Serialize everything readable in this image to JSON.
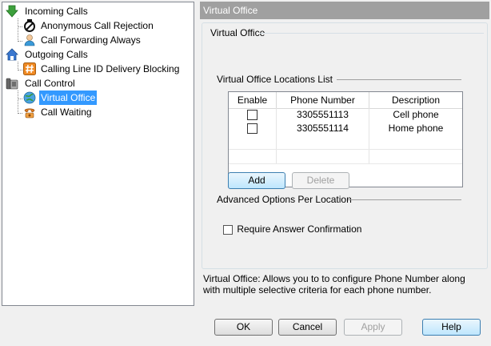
{
  "tree": {
    "items": [
      {
        "label": "Incoming Calls"
      },
      {
        "label": "Anonymous Call Rejection"
      },
      {
        "label": "Call Forwarding Always"
      },
      {
        "label": "Outgoing Calls"
      },
      {
        "label": "Calling Line ID Delivery Blocking"
      },
      {
        "label": "Call Control"
      },
      {
        "label": "Virtual Office"
      },
      {
        "label": "Call Waiting"
      }
    ]
  },
  "header": {
    "title": "Virtual Office"
  },
  "panel": {
    "group_title": "Virtual Office",
    "locations_title": "Virtual Office Locations List",
    "advanced_title": "Advanced Options Per Location",
    "confirm_label": "Require Answer Confirmation"
  },
  "table": {
    "columns": [
      "Enable",
      "Phone Number",
      "Description"
    ],
    "rows": [
      {
        "phone": "3305551113",
        "desc": "Cell phone"
      },
      {
        "phone": "3305551114",
        "desc": "Home phone"
      }
    ]
  },
  "buttons": {
    "add": "Add",
    "delete": "Delete",
    "ok": "OK",
    "cancel": "Cancel",
    "apply": "Apply",
    "help": "Help"
  },
  "description": "Virtual Office: Allows you to to configure Phone Number along with multiple selective criteria for each phone number.",
  "colors": {
    "selection": "#3399ff",
    "header_bar": "#a0a0a0",
    "incoming_icon": "#3ca03c",
    "outgoing_icon": "#3a78d0"
  },
  "icons": {
    "incoming": "down-arrow-icon",
    "anonymous": "blocked-phone-icon",
    "forwarding": "person-icon",
    "outgoing": "house-icon",
    "clid": "hash-icon",
    "control": "phone-icon",
    "virtual": "globe-icon",
    "waiting": "phone-ringing-icon"
  }
}
